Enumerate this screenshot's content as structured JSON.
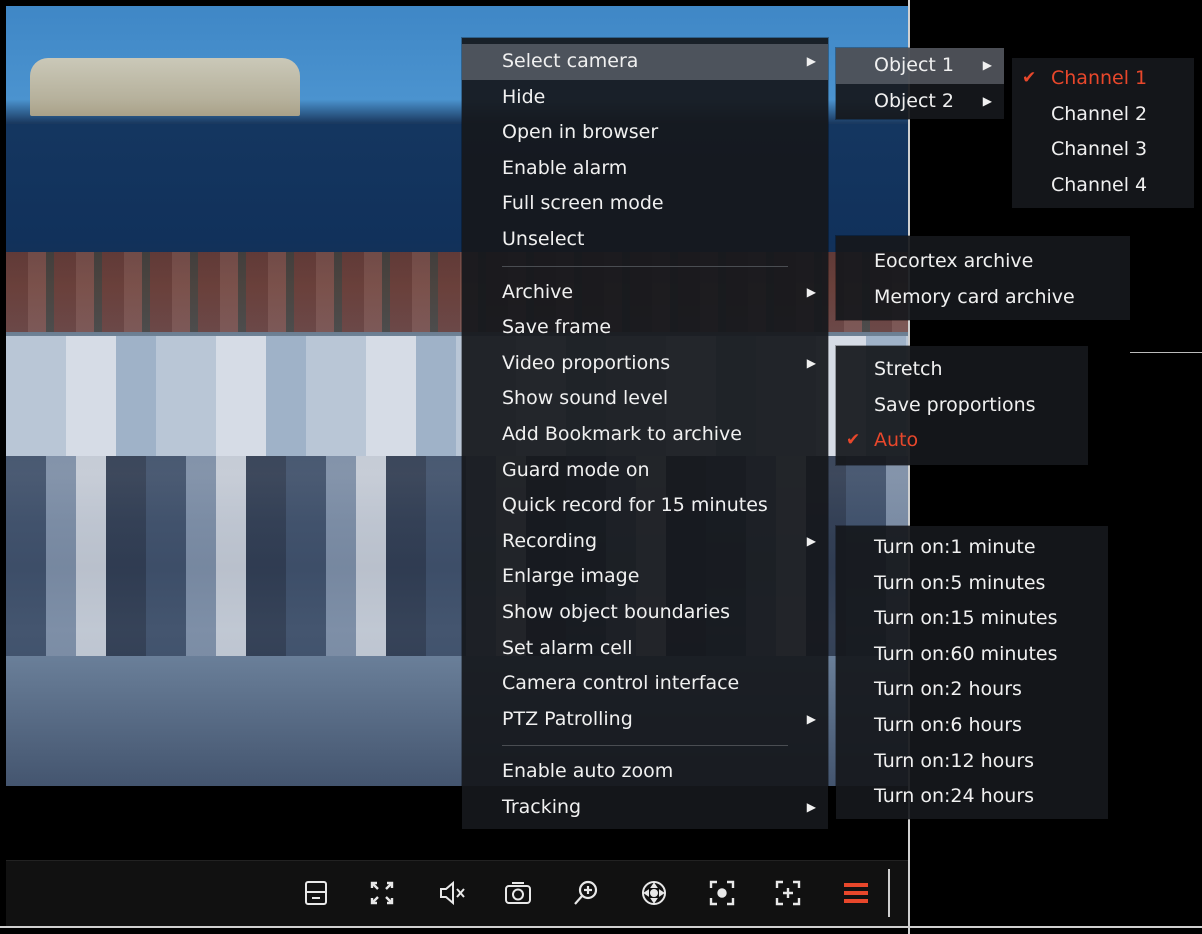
{
  "main_menu": {
    "items": [
      {
        "label": "Select camera",
        "has_submenu": true,
        "highlighted": true
      },
      {
        "label": "Hide"
      },
      {
        "label": "Open in browser"
      },
      {
        "label": "Enable alarm"
      },
      {
        "label": "Full screen mode"
      },
      {
        "label": "Unselect"
      },
      {
        "label": "Archive",
        "has_submenu": true
      },
      {
        "label": "Save frame"
      },
      {
        "label": "Video proportions",
        "has_submenu": true
      },
      {
        "label": "Show sound level"
      },
      {
        "label": "Add Bookmark to archive"
      },
      {
        "label": "Guard mode on"
      },
      {
        "label": "Quick record for 15 minutes"
      },
      {
        "label": "Recording",
        "has_submenu": true
      },
      {
        "label": "Enlarge image"
      },
      {
        "label": "Show object boundaries"
      },
      {
        "label": "Set alarm cell"
      },
      {
        "label": "Camera control interface"
      },
      {
        "label": "PTZ Patrolling",
        "has_submenu": true
      },
      {
        "label": "Enable auto zoom"
      },
      {
        "label": "Tracking",
        "has_submenu": true
      }
    ]
  },
  "objects_menu": {
    "items": [
      {
        "label": "Object 1",
        "has_submenu": true,
        "highlighted": true
      },
      {
        "label": "Object 2",
        "has_submenu": true
      }
    ]
  },
  "channels_menu": {
    "items": [
      {
        "label": "Channel 1",
        "checked": true
      },
      {
        "label": "Channel 2"
      },
      {
        "label": "Channel 3"
      },
      {
        "label": "Channel 4"
      }
    ]
  },
  "archive_menu": {
    "items": [
      {
        "label": "Eocortex archive"
      },
      {
        "label": "Memory card archive"
      }
    ]
  },
  "proportions_menu": {
    "items": [
      {
        "label": "Stretch"
      },
      {
        "label": "Save proportions"
      },
      {
        "label": "Auto",
        "checked": true
      }
    ]
  },
  "recording_menu": {
    "items": [
      {
        "label": "Turn on:1 minute"
      },
      {
        "label": "Turn on:5 minutes"
      },
      {
        "label": "Turn on:15 minutes"
      },
      {
        "label": "Turn on:60 minutes"
      },
      {
        "label": "Turn on:2 hours"
      },
      {
        "label": "Turn on:6 hours"
      },
      {
        "label": "Turn on:12 hours"
      },
      {
        "label": "Turn on:24 hours"
      }
    ]
  },
  "toolbar": {
    "buttons": [
      "layout-icon",
      "fullscreen-icon",
      "mute-icon",
      "snapshot-icon",
      "zoom-in-icon",
      "ptz-icon",
      "focus-icon",
      "digital-zoom-icon",
      "menu-icon"
    ]
  },
  "colors": {
    "accent": "#e8472b",
    "menu_bg": "#16181c",
    "highlight": "#787d87"
  }
}
